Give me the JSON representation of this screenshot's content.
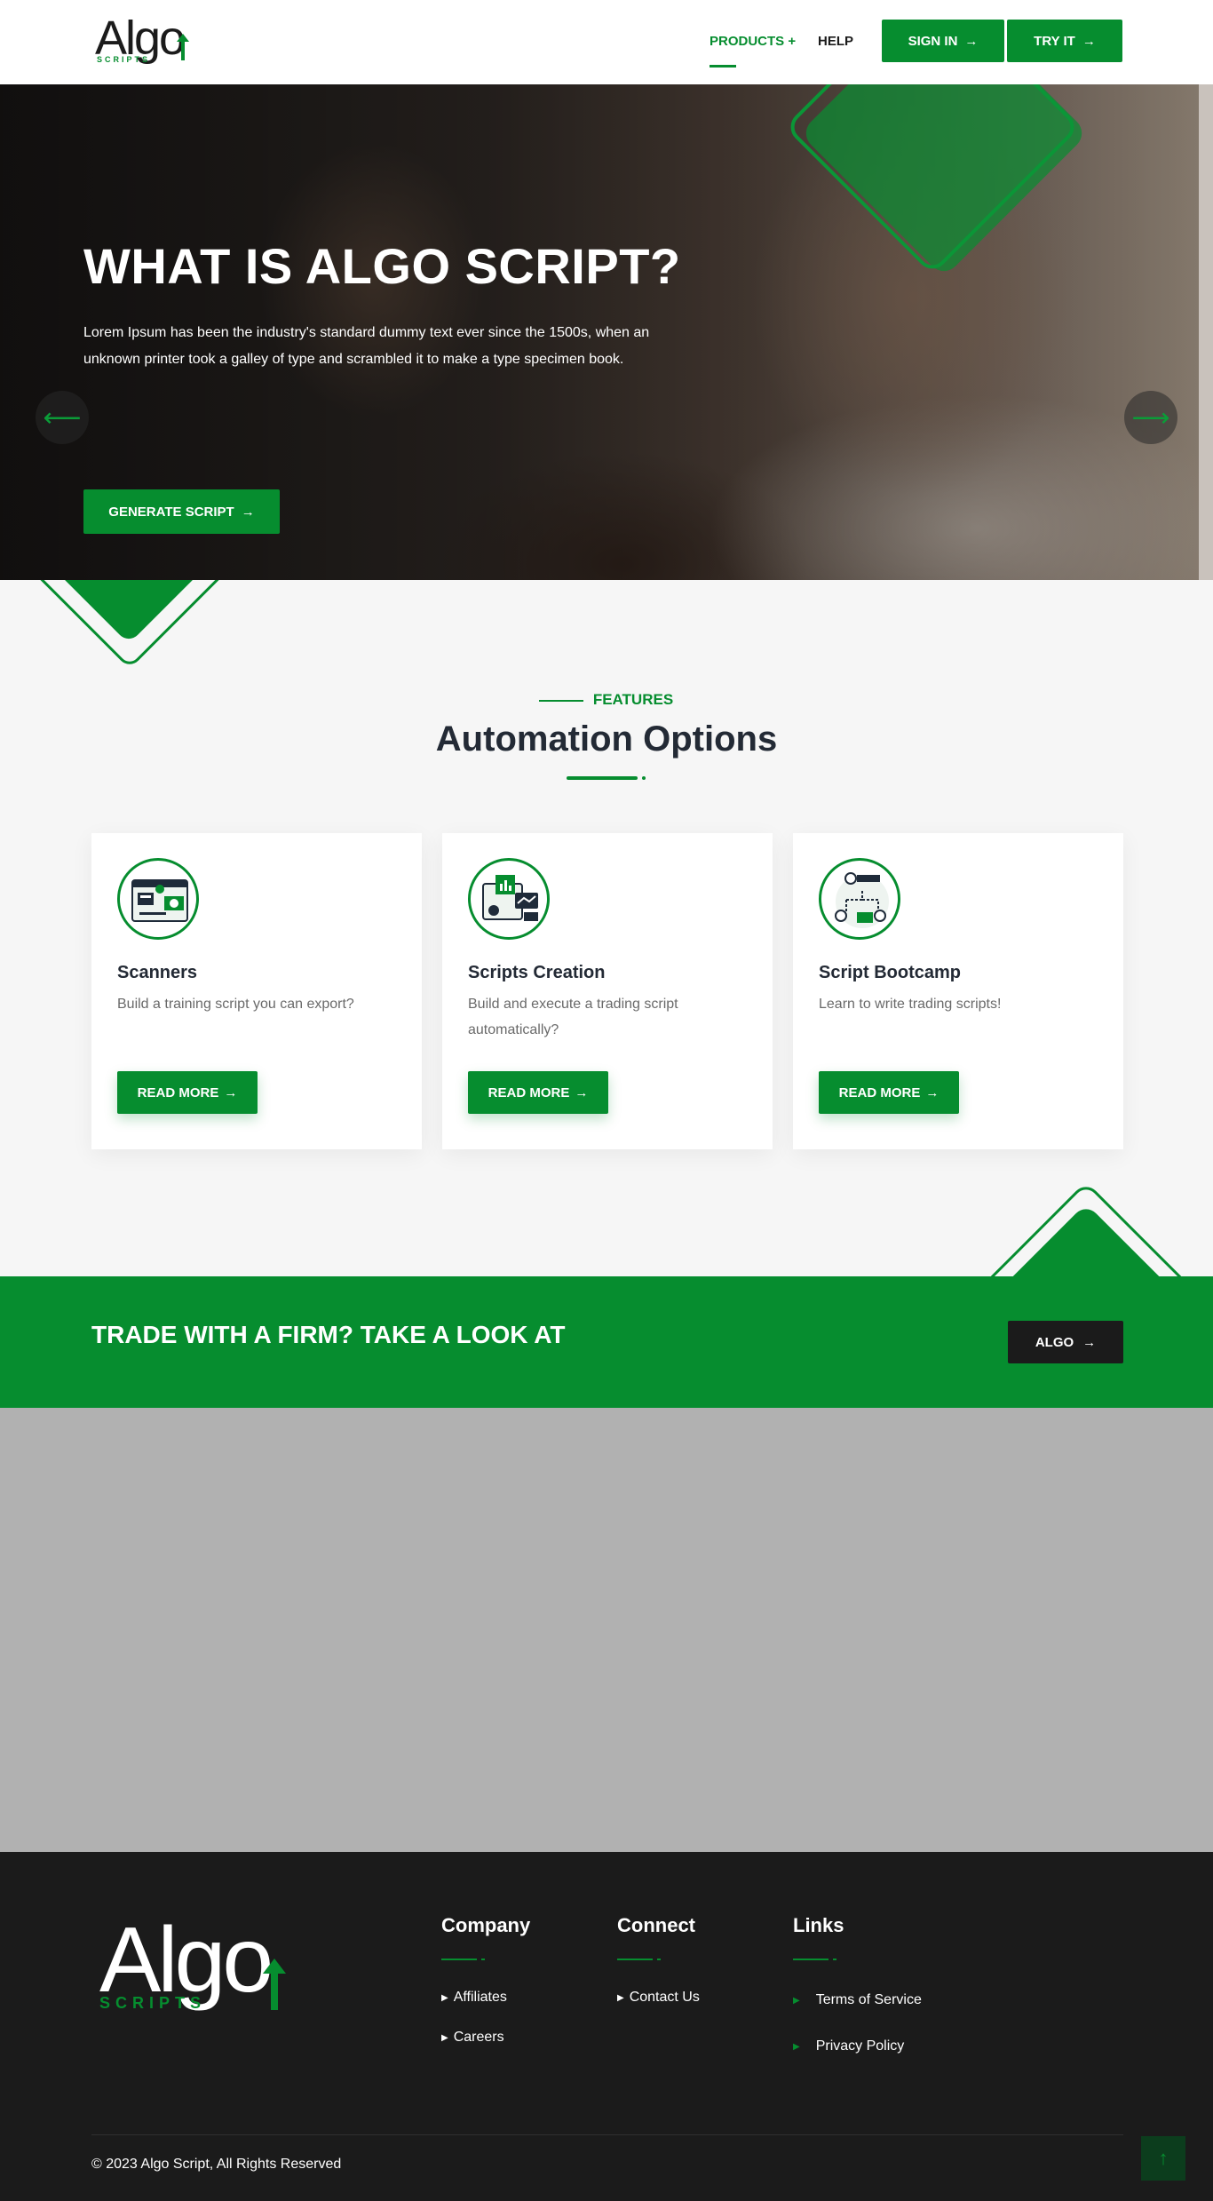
{
  "header": {
    "logo_text": "Algo",
    "logo_sub": "SCRIPTS",
    "nav_products": "PRODUCTS +",
    "nav_help": "HELP",
    "signin_label": "SIGN IN",
    "tryit_label": "TRY IT"
  },
  "hero": {
    "title": "WHAT IS ALGO SCRIPT?",
    "text": "Lorem Ipsum has been the industry's standard dummy text ever since the 1500s, when an unknown printer took a galley of type and scrambled it to make a type specimen book.",
    "cta_label": "GENERATE SCRIPT",
    "prev_icon": "arrow-left-icon",
    "next_icon": "arrow-right-icon"
  },
  "features": {
    "kicker": "FEATURES",
    "title": "Automation Options",
    "cards": [
      {
        "title": "Scanners",
        "desc": "Build a training script you can export?",
        "button": "READ MORE",
        "icon": "scanner-icon"
      },
      {
        "title": "Scripts Creation",
        "desc": "Build and execute a trading script automatically?",
        "button": "READ MORE",
        "icon": "script-creation-icon"
      },
      {
        "title": "Script Bootcamp",
        "desc": "Learn to write trading scripts!",
        "button": "READ MORE",
        "icon": "bootcamp-icon"
      }
    ]
  },
  "banner": {
    "text": "TRADE WITH A FIRM? TAKE A LOOK AT",
    "button": "ALGO"
  },
  "footer": {
    "logo_text": "Algo",
    "logo_sub": "SCRIPTS",
    "columns": [
      {
        "title": "Company",
        "links": [
          "Affiliates",
          "Careers"
        ]
      },
      {
        "title": "Connect",
        "links": [
          "Contact Us"
        ]
      },
      {
        "title": "Links",
        "links": [
          "Terms of Service",
          "Privacy Policy"
        ]
      }
    ],
    "copyright": "© 2023 Algo Script, All Rights Reserved"
  },
  "colors": {
    "brand_green": "#068d2f",
    "dark": "#1b1b1b"
  }
}
